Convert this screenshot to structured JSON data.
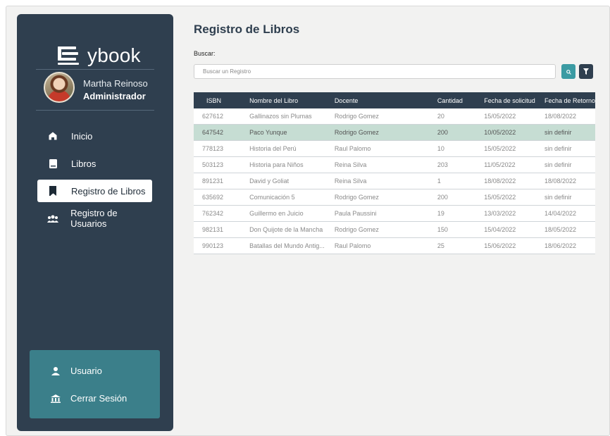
{
  "app": {
    "logo_text": "ybook",
    "user_name": "Martha Reinoso",
    "user_role": "Administrador"
  },
  "nav": [
    {
      "label": "Inicio",
      "icon": "home-icon"
    },
    {
      "label": "Libros",
      "icon": "book-icon"
    },
    {
      "label": "Registro de Libros",
      "icon": "bookmark-book-icon",
      "active": true
    },
    {
      "label": "Registro de Usuarios",
      "icon": "users-icon"
    }
  ],
  "user_menu": {
    "usuario_label": "Usuario",
    "logout_label": "Cerrar Sesión"
  },
  "page": {
    "title": "Registro de Libros",
    "search_label": "Buscar:",
    "search_placeholder": "Buscar un Registro",
    "search_value": ""
  },
  "table": {
    "headers": [
      "ISBN",
      "Nombre del Libro",
      "Docente",
      "Cantidad",
      "Fecha de solicitud",
      "Fecha de Retorno"
    ],
    "rows": [
      [
        "627612",
        "Gallinazos sin Plumas",
        "Rodrigo Gomez",
        "20",
        "15/05/2022",
        "18/08/2022"
      ],
      [
        "647542",
        "Paco Yunque",
        "Rodrigo Gomez",
        "200",
        "10/05/2022",
        "sin definir"
      ],
      [
        "778123",
        "Historia del Perú",
        "Raul Palomo",
        "10",
        "15/05/2022",
        "sin definir"
      ],
      [
        "503123",
        "Historia para Niños",
        "Reina Silva",
        "203",
        "11/05/2022",
        "sin definir"
      ],
      [
        "891231",
        "David y Goliat",
        "Reina Silva",
        "1",
        "18/08/2022",
        "18/08/2022"
      ],
      [
        "635692",
        "Comunicación 5",
        "Rodrigo Gomez",
        "200",
        "15/05/2022",
        "sin definir"
      ],
      [
        "762342",
        "Guillermo en Juicio",
        "Paula Paussini",
        "19",
        "13/03/2022",
        "14/04/2022"
      ],
      [
        "982131",
        "Don Quijote de la Mancha",
        "Rodrigo Gomez",
        "150",
        "15/04/2022",
        "18/05/2022"
      ],
      [
        "990123",
        "Batallas del Mundo Antig...",
        "Raul Palomo",
        "25",
        "15/06/2022",
        "18/06/2022"
      ]
    ],
    "highlighted_row": 1
  },
  "colors": {
    "sidebar": "#2f3f4f",
    "accent": "#3b7f8a",
    "search_button": "#3b9ba3",
    "row_highlight": "#c6ddd3"
  }
}
